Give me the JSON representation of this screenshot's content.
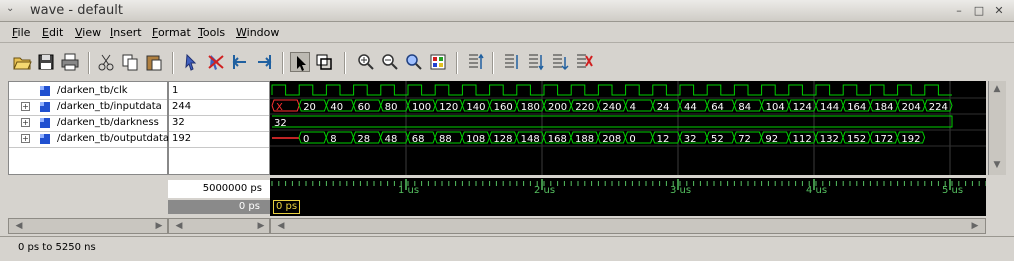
{
  "window": {
    "title": "wave - default"
  },
  "menu": [
    {
      "label": "File",
      "ul": "F",
      "rest": "ile"
    },
    {
      "label": "Edit",
      "ul": "E",
      "rest": "dit"
    },
    {
      "label": "View",
      "ul": "V",
      "rest": "iew"
    },
    {
      "label": "Insert",
      "ul": "I",
      "rest": "nsert"
    },
    {
      "label": "Format",
      "ul": "F",
      "rest": "ormat"
    },
    {
      "label": "Tools",
      "ul": "T",
      "rest": "ools"
    },
    {
      "label": "Window",
      "ul": "W",
      "rest": "indow"
    }
  ],
  "toolbar": {
    "icons": [
      "open-folder-icon",
      "save-icon",
      "print-icon",
      "cut-icon",
      "copy-icon",
      "paste-icon",
      "select-icon",
      "delete-icon",
      "insert-left-icon",
      "insert-right-icon",
      "pointer-icon",
      "zoom-box-icon",
      "zoom-in-icon",
      "zoom-out-icon",
      "zoom-full-icon",
      "zoom-cursor-icon",
      "find-icon",
      "prev-edge-icon",
      "next-edge-icon",
      "expand-icon",
      "remove-icon"
    ]
  },
  "signals": [
    {
      "name": "/darken_tb/clk",
      "value": "1",
      "expandable": false
    },
    {
      "name": "/darken_tb/inputdata",
      "value": "244",
      "expandable": true
    },
    {
      "name": "/darken_tb/darkness",
      "value": "32",
      "expandable": true
    },
    {
      "name": "/darken_tb/outputdata",
      "value": "192",
      "expandable": true
    }
  ],
  "waves": {
    "inputdata": [
      "X",
      "20",
      "40",
      "60",
      "80",
      "100",
      "120",
      "140",
      "160",
      "180",
      "200",
      "220",
      "240",
      "4",
      "24",
      "44",
      "64",
      "84",
      "104",
      "124",
      "144",
      "164",
      "184",
      "204",
      "224"
    ],
    "darkness": [
      "32"
    ],
    "outputdata": [
      "0",
      "8",
      "28",
      "48",
      "68",
      "88",
      "108",
      "128",
      "148",
      "168",
      "188",
      "208",
      "0",
      "12",
      "32",
      "52",
      "72",
      "92",
      "112",
      "132",
      "152",
      "172",
      "192"
    ]
  },
  "cursor": {
    "time_readout": "5000000 ps",
    "cursor_delta": "0 ps",
    "cursor_label": "0 ps"
  },
  "ruler": {
    "labels": [
      "1 us",
      "2 us",
      "3 us",
      "4 us",
      "5 us"
    ]
  },
  "status": {
    "range": "0 ps to 5250 ns"
  },
  "colors": {
    "wave": "#00d000",
    "grid": "#3c3c3c",
    "cursor": "#e8d040",
    "undefined": "#ff3030"
  }
}
